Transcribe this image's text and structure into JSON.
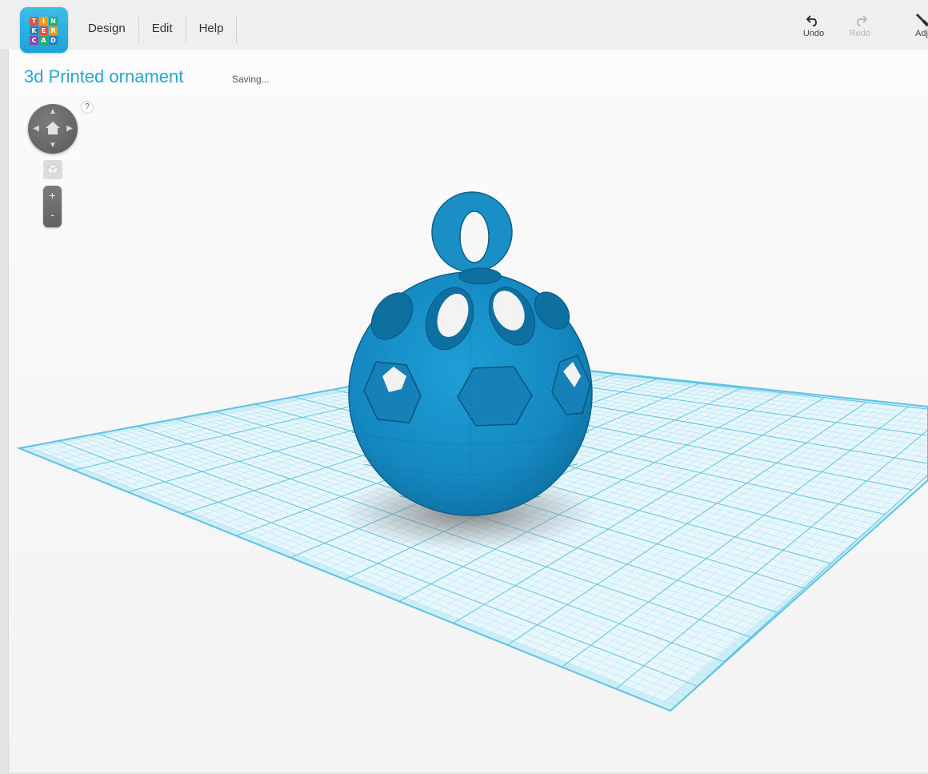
{
  "app": {
    "logo_letters": [
      "T",
      "I",
      "N",
      "K",
      "E",
      "R",
      "C",
      "A",
      "D"
    ],
    "logo_colors": [
      "#e94b3c",
      "#f39c12",
      "#27ae60",
      "#2980b9",
      "#e94b3c",
      "#f39c12",
      "#8e44ad",
      "#27ae60",
      "#2980b9"
    ]
  },
  "menu": {
    "items": [
      {
        "label": "Design"
      },
      {
        "label": "Edit"
      },
      {
        "label": "Help"
      }
    ]
  },
  "toolbar": {
    "undo_label": "Undo",
    "redo_label": "Redo",
    "adjust_label": "Adj"
  },
  "design": {
    "title": "3d Printed ornament",
    "status": "Saving..."
  },
  "view_controls": {
    "help_label": "?",
    "zoom_in_label": "+",
    "zoom_out_label": "-"
  },
  "colors": {
    "accent": "#2aa7cf",
    "object": "#1a8fc6",
    "grid": "#7dd0ea"
  }
}
